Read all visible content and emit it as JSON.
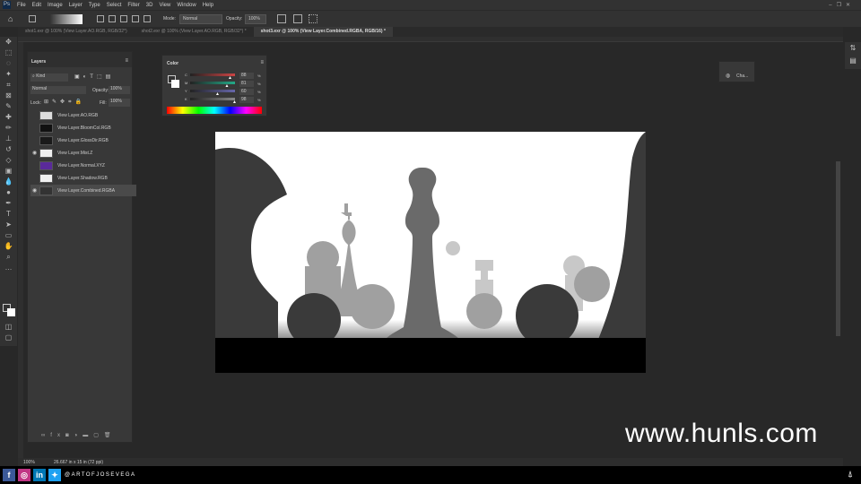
{
  "menu": [
    "File",
    "Edit",
    "Image",
    "Layer",
    "Type",
    "Select",
    "Filter",
    "3D",
    "View",
    "Window",
    "Help"
  ],
  "app_icon": "Ps",
  "options": {
    "mode_label": "Mode:",
    "mode_value": "Normal",
    "opacity_label": "Opacity:",
    "opacity_value": "100%"
  },
  "tabs": [
    {
      "label": "shot1.exr @ 100% (View Layer.AO.RGB, RGB/32*)",
      "active": false
    },
    {
      "label": "shot2.exr @ 100% (View Layer.AO.RGB, RGB/32*) *",
      "active": false
    },
    {
      "label": "shot3.exr @ 100% (View Layer.Combined.RGBA, RGB/16) *",
      "active": true
    }
  ],
  "layers_panel": {
    "title": "Layers",
    "filter": "Kind",
    "blend": "Normal",
    "opacity_label": "Opacity:",
    "opacity_value": "100%",
    "lock_label": "Lock:",
    "fill_label": "Fill:",
    "fill_value": "100%",
    "layers": [
      {
        "name": "View Layer.AO.RGB",
        "visible": false,
        "thumb": "#ddd"
      },
      {
        "name": "View Layer.BloomCol.RGB",
        "visible": false,
        "thumb": "#111"
      },
      {
        "name": "View Layer.GlossDir.RGB",
        "visible": false,
        "thumb": "#1a1a1a"
      },
      {
        "name": "View Layer.Mist.Z",
        "visible": true,
        "thumb": "#eee"
      },
      {
        "name": "View Layer.Normal.XYZ",
        "visible": false,
        "thumb": "#5a2a9a"
      },
      {
        "name": "View Layer.Shadow.RGB",
        "visible": false,
        "thumb": "#f0f0f0"
      },
      {
        "name": "View Layer.Combined.RGBA",
        "visible": true,
        "thumb": "#333",
        "selected": true
      }
    ]
  },
  "color_panel": {
    "title": "Color",
    "channels": [
      {
        "label": "C",
        "value": "88",
        "color": "#c44"
      },
      {
        "label": "M",
        "value": "81",
        "color": "#2a8"
      },
      {
        "label": "Y",
        "value": "60",
        "color": "#66a"
      },
      {
        "label": "K",
        "value": "98",
        "color": "#888"
      }
    ],
    "unit": "%"
  },
  "channels_panel": {
    "label": "Cha..."
  },
  "status": {
    "zoom": "100%",
    "doc_size": "26.667 in x 15 in (72 ppi)"
  },
  "social": {
    "handle": "@ARTOFJOSEVEGA"
  },
  "watermark": "www.hunls.com"
}
